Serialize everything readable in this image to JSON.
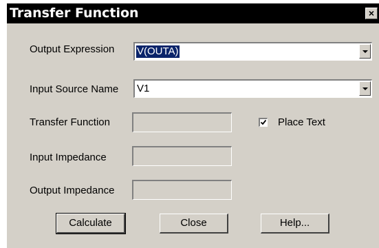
{
  "dialog": {
    "title": "Transfer Function",
    "close_glyph": "×"
  },
  "form": {
    "output_expression": {
      "label": "Output Expression",
      "value": "V(OUTA)"
    },
    "input_source": {
      "label": "Input Source Name",
      "value": "V1"
    },
    "transfer_function": {
      "label": "Transfer Function",
      "value": ""
    },
    "input_impedance": {
      "label": "Input Impedance",
      "value": ""
    },
    "output_impedance": {
      "label": "Output Impedance",
      "value": ""
    },
    "place_text": {
      "label": "Place Text",
      "checked": true
    }
  },
  "buttons": {
    "calculate": "Calculate",
    "close": "Close",
    "help": "Help..."
  },
  "icons": {
    "dropdown": "chevron-down-icon",
    "check": "check-icon",
    "close": "close-icon"
  }
}
